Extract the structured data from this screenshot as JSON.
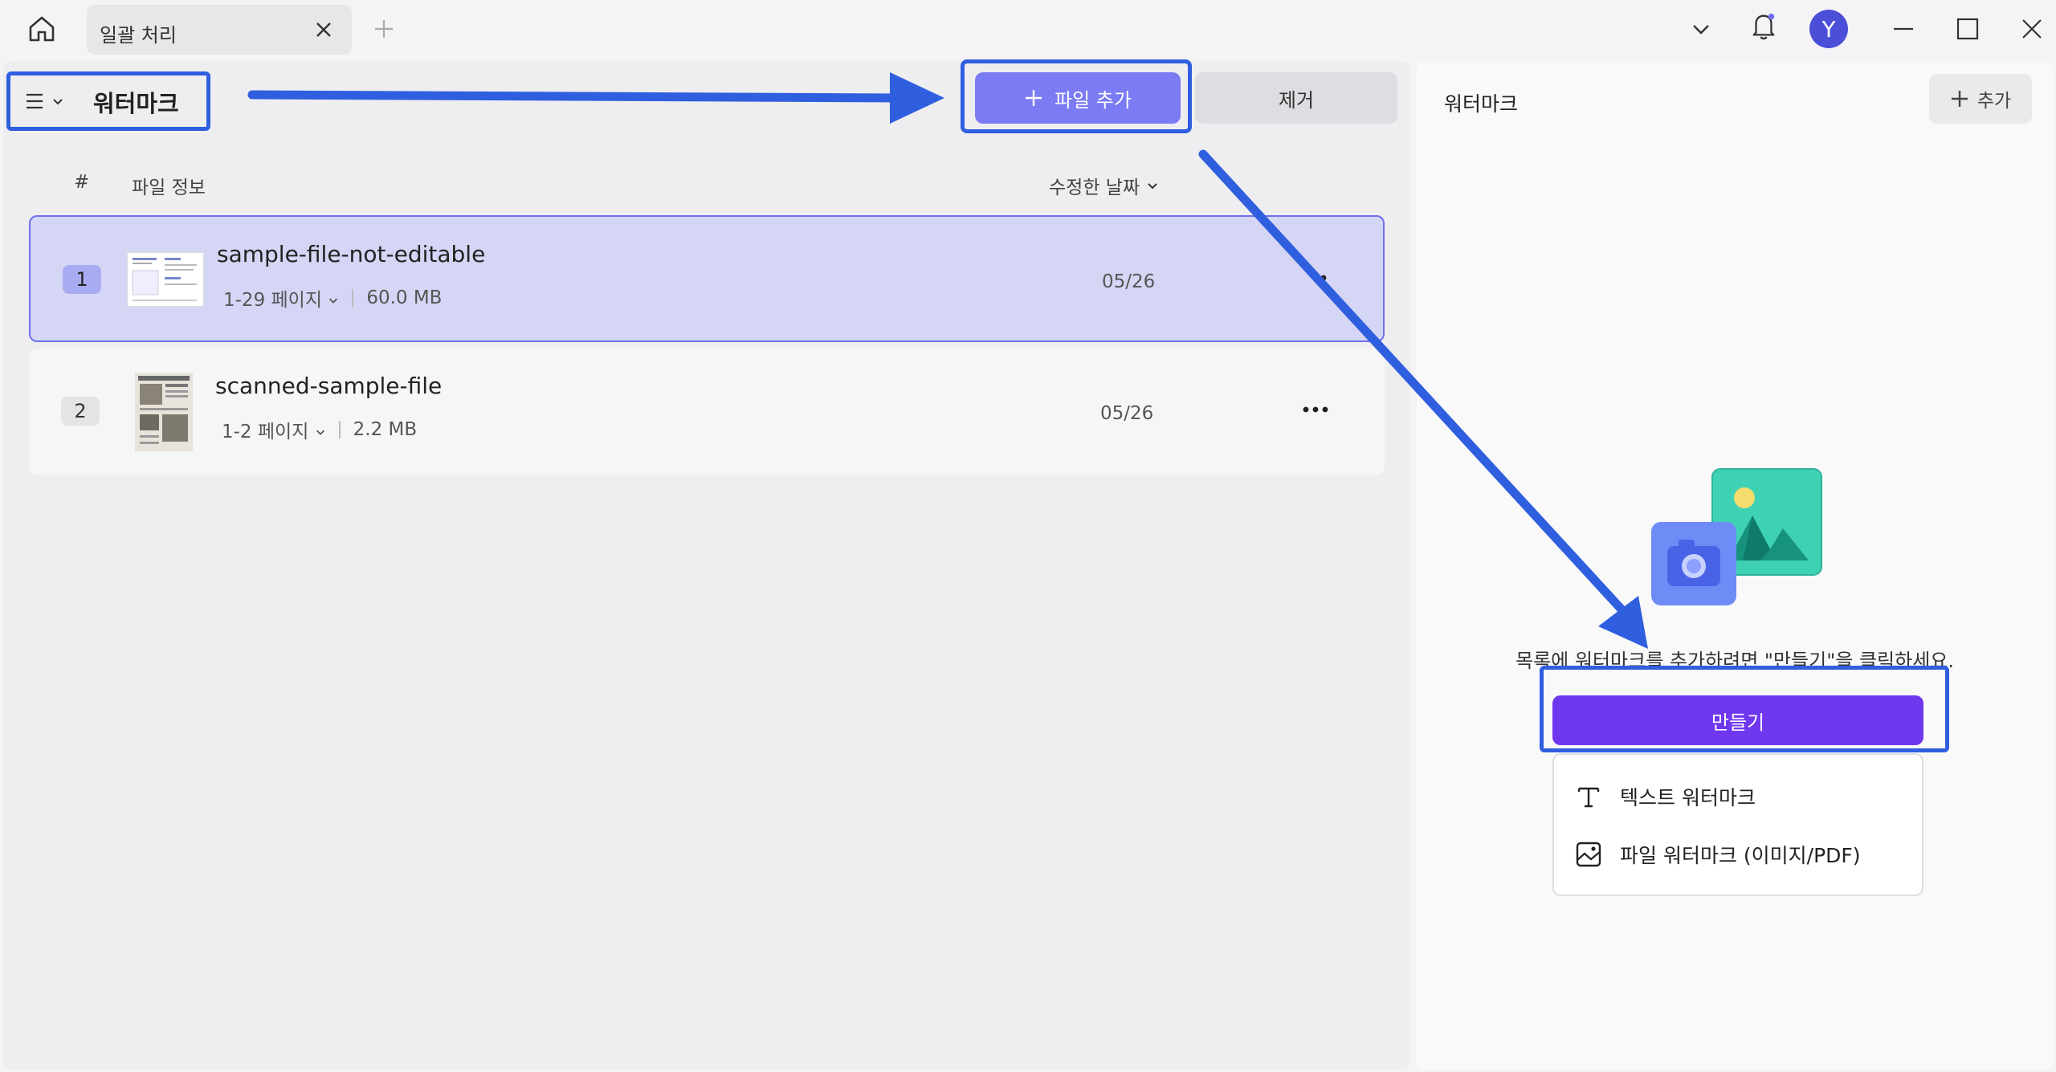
{
  "titlebar": {
    "tab_label": "일괄 처리",
    "avatar_letter": "Y"
  },
  "toolbar": {
    "mode_title": "워터마크",
    "add_file_label": "파일 추가",
    "remove_label": "제거"
  },
  "table": {
    "col_number": "#",
    "col_info": "파일 정보",
    "col_date": "수정한 날짜",
    "rows": [
      {
        "num": "1",
        "name": "sample-file-not-editable",
        "pages": "1-29 페이지",
        "size": "60.0 MB",
        "date": "05/26",
        "selected": true
      },
      {
        "num": "2",
        "name": "scanned-sample-file",
        "pages": "1-2 페이지",
        "size": "2.2 MB",
        "date": "05/26",
        "selected": false
      }
    ]
  },
  "right_panel": {
    "title": "워터마크",
    "add_label": "추가",
    "empty_message": "목록에 워터마크를 추가하려면 \"만들기\"을 클릭하세요.",
    "create_label": "만들기",
    "menu": [
      {
        "icon": "text-t-icon",
        "label": "텍스트 워터마크"
      },
      {
        "icon": "image-file-icon",
        "label": "파일 워터마크 (이미지/PDF)"
      }
    ]
  },
  "colors": {
    "accent": "#7b7bf4",
    "create": "#6f38ef",
    "annotation": "#2f5fdf",
    "selected_row": "#d5d6f5"
  }
}
